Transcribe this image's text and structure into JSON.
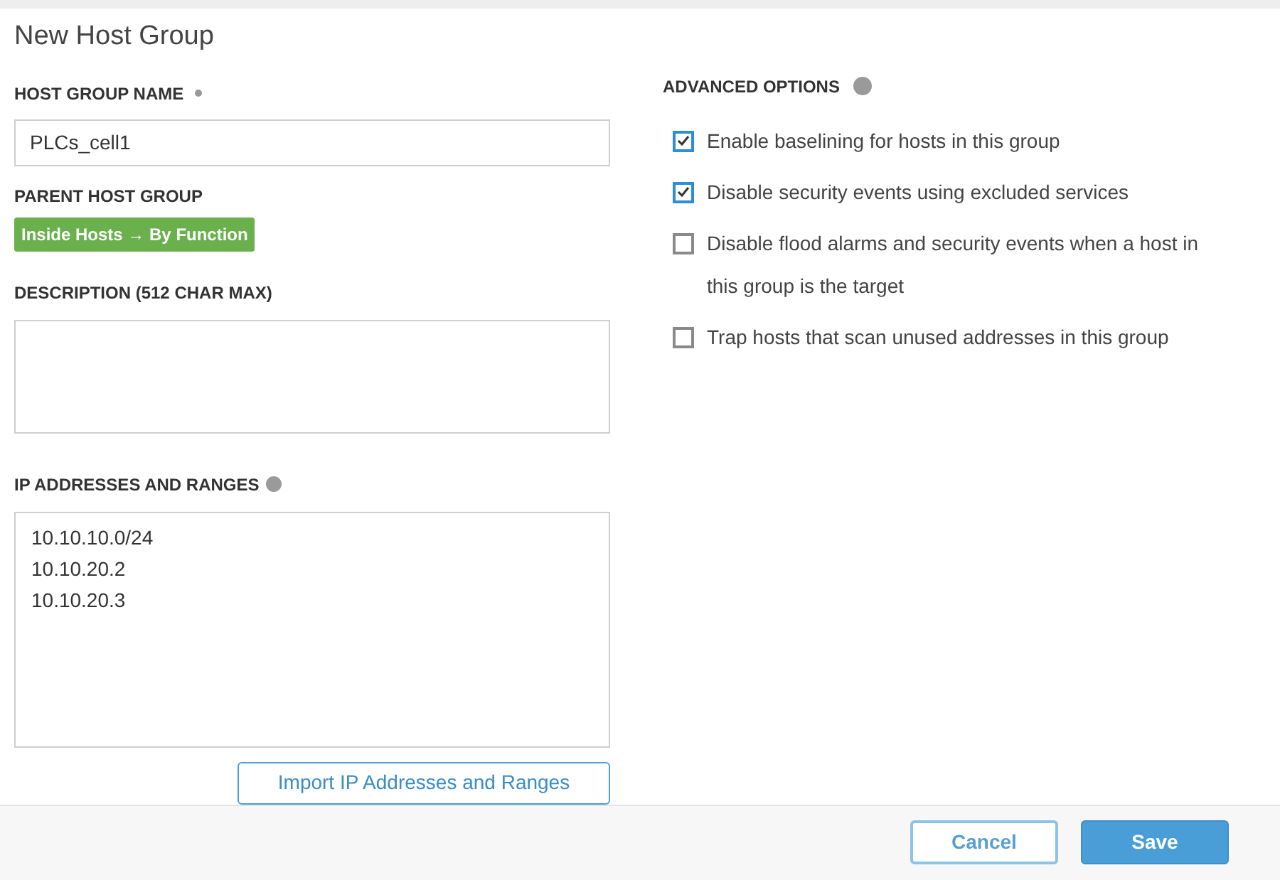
{
  "dialog": {
    "title": "New Host Group"
  },
  "host_group_name": {
    "label": "HOST GROUP NAME",
    "required": true,
    "value": "PLCs_cell1"
  },
  "parent_host_group": {
    "label": "PARENT HOST GROUP",
    "badge": "Inside Hosts → By Function"
  },
  "description": {
    "label": "DESCRIPTION (512 CHAR MAX)"
  },
  "ip_addresses": {
    "label": "IP ADDRESSES AND RANGES",
    "lines": [
      "10.10.10.0/24",
      "10.10.20.2",
      "10.10.20.3"
    ],
    "import_button": "Import IP Addresses and Ranges"
  },
  "advanced_options": {
    "label": "ADVANCED OPTIONS",
    "options": [
      {
        "label": "Enable baselining for hosts in this group",
        "checked": true
      },
      {
        "label": "Disable security events using excluded services",
        "checked": true
      },
      {
        "label": "Disable flood alarms and security events when a host in this group is the target",
        "checked": false
      },
      {
        "label": "Trap hosts that scan unused addresses in this group",
        "checked": false
      }
    ]
  },
  "footer": {
    "buttons": [
      {
        "label": "Cancel",
        "kind": "secondary"
      },
      {
        "label": "Save",
        "kind": "primary"
      }
    ]
  }
}
